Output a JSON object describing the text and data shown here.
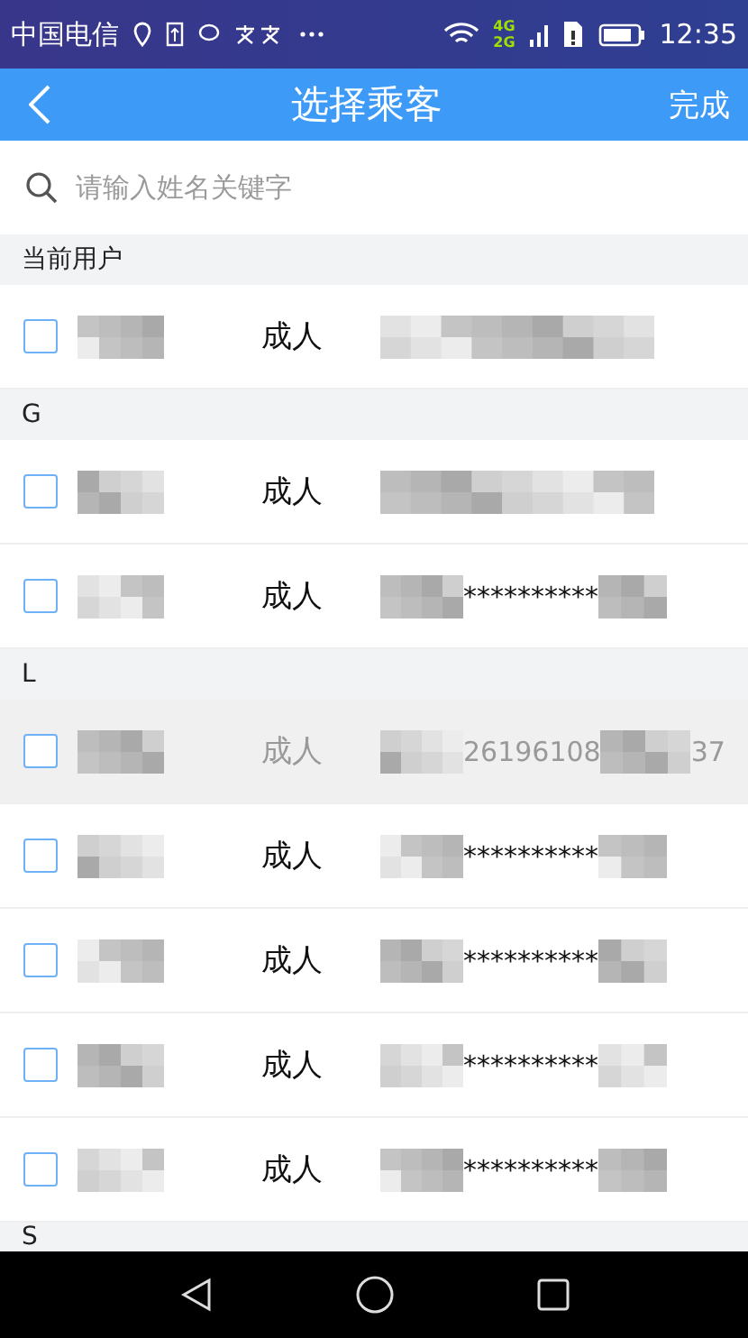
{
  "status_bar": {
    "carrier": "中国电信",
    "network_top": "4G",
    "network_bottom": "2G",
    "time": "12:35"
  },
  "nav": {
    "title": "选择乘客",
    "action": "完成"
  },
  "search": {
    "placeholder": "请输入姓名关键字"
  },
  "sections": [
    {
      "header": "当前用户",
      "rows": [
        {
          "checked": false,
          "disabled": false,
          "type": "成人",
          "id_parts": []
        }
      ]
    },
    {
      "header": "G",
      "rows": [
        {
          "checked": false,
          "disabled": false,
          "type": "成人",
          "id_parts": []
        },
        {
          "checked": false,
          "disabled": false,
          "type": "成人",
          "id_parts": [
            "**********"
          ]
        }
      ]
    },
    {
      "header": "L",
      "rows": [
        {
          "checked": false,
          "disabled": true,
          "type": "成人",
          "id_parts": [
            "26196108",
            "37"
          ]
        },
        {
          "checked": false,
          "disabled": false,
          "type": "成人",
          "id_parts": [
            "**********"
          ]
        },
        {
          "checked": false,
          "disabled": false,
          "type": "成人",
          "id_parts": [
            "**********"
          ]
        },
        {
          "checked": false,
          "disabled": false,
          "type": "成人",
          "id_parts": [
            "**********"
          ]
        },
        {
          "checked": false,
          "disabled": false,
          "type": "成人",
          "id_parts": [
            "**********"
          ]
        }
      ]
    },
    {
      "header": "S"
    }
  ]
}
